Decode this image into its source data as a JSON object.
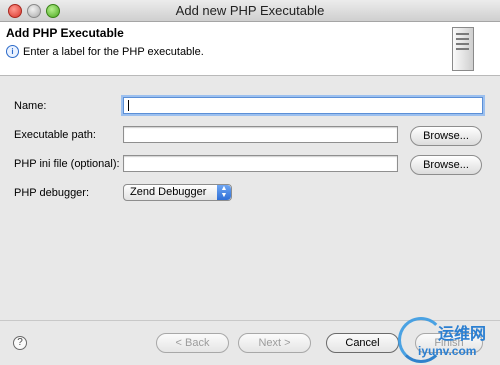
{
  "window": {
    "title": "Add new PHP Executable"
  },
  "banner": {
    "heading": "Add PHP Executable",
    "message": "Enter a label for the PHP executable."
  },
  "form": {
    "name": {
      "label": "Name:",
      "value": ""
    },
    "executable_path": {
      "label": "Executable path:",
      "value": "",
      "browse_label": "Browse..."
    },
    "php_ini": {
      "label": "PHP ini file (optional):",
      "value": "",
      "browse_label": "Browse..."
    },
    "debugger": {
      "label": "PHP debugger:",
      "selected": "Zend Debugger"
    }
  },
  "footer": {
    "help_glyph": "?",
    "back_label": "< Back",
    "next_label": "Next >",
    "cancel_label": "Cancel",
    "finish_label": "Finish"
  },
  "watermark": {
    "top": "运维网",
    "bottom": "iyunv.com"
  },
  "colors": {
    "accent": "#2f6fd6",
    "focus_ring": "#9cc0ef",
    "watermark": "#2b7fd1"
  }
}
